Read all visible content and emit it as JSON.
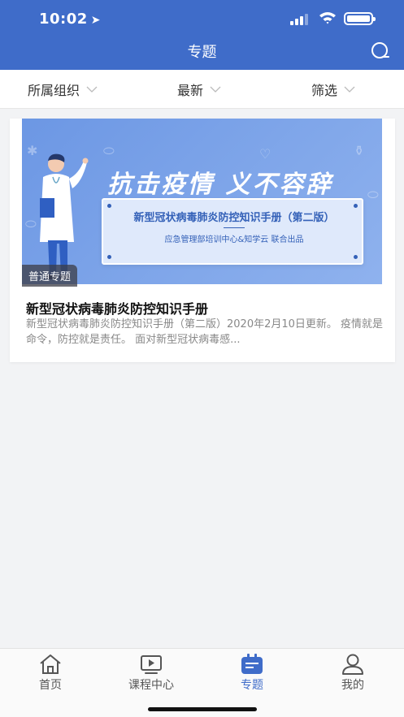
{
  "status_bar": {
    "time": "10:02"
  },
  "header": {
    "title": "专题",
    "accent_color": "#3f6cc9",
    "search_icon": "search-icon"
  },
  "filters": [
    {
      "label": "所属组织"
    },
    {
      "label": "最新"
    },
    {
      "label": "筛选"
    }
  ],
  "topic_card": {
    "banner": {
      "slogan": "抗击疫情 义不容辞",
      "book_title": "新型冠状病毒肺炎防控知识手册（第二版）",
      "book_subtitle": "应急管理部培训中心&知学云  联合出品"
    },
    "badge": "普通专题",
    "title": "新型冠状病毒肺炎防控知识手册",
    "description": "新型冠状病毒肺炎防控知识手册（第二版）2020年2月10日更新。 疫情就是命令，防控就是责任。 面对新型冠状病毒感..."
  },
  "tab_bar": {
    "tabs": [
      {
        "label": "首页",
        "icon": "home-icon"
      },
      {
        "label": "课程中心",
        "icon": "video-icon"
      },
      {
        "label": "专题",
        "icon": "topic-icon",
        "active": true
      },
      {
        "label": "我的",
        "icon": "user-icon"
      }
    ]
  }
}
